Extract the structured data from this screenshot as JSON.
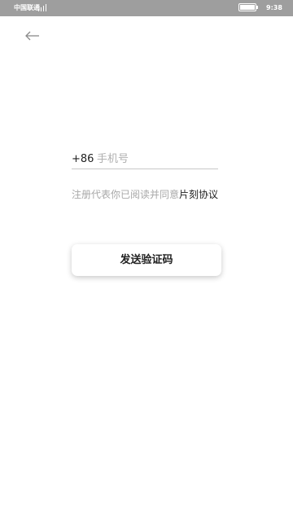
{
  "status_bar": {
    "carrier": "中国联通",
    "time": "9:38",
    "signal_icon": "signal-icon",
    "battery_icon": "battery-icon",
    "battery_level": 1.0
  },
  "header": {
    "back_icon": "arrow-left-icon"
  },
  "login": {
    "country_code": "+86",
    "phone_placeholder": "手机号",
    "phone_value": "",
    "agreement_text": "注册代表你已阅读并同意",
    "agreement_link": "片刻协议",
    "send_button_label": "发送验证码"
  },
  "colors": {
    "status_bar_bg": "#9e9e9e",
    "text_primary": "#222222",
    "text_muted": "#a8a8a8",
    "divider": "#c8c8c8"
  }
}
